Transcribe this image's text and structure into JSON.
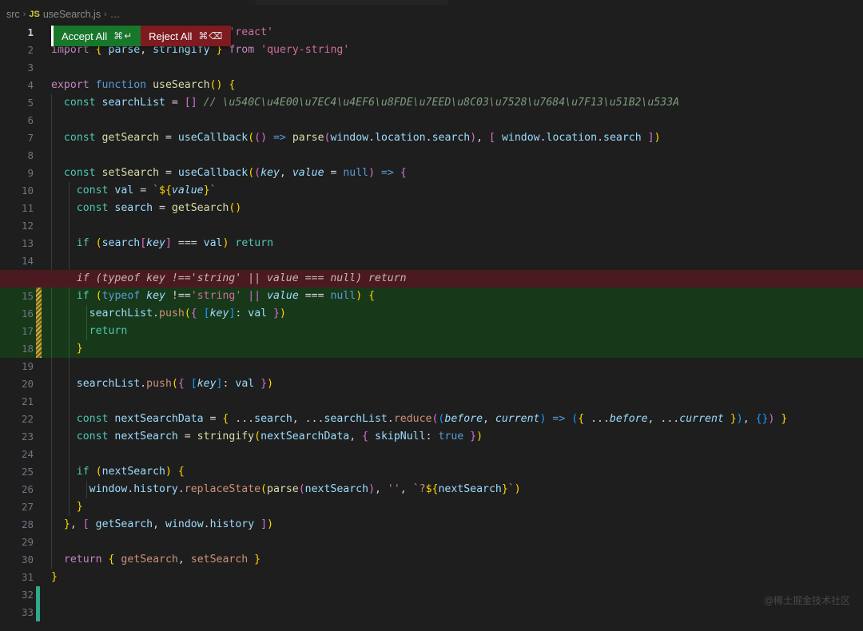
{
  "window": {
    "theme_bg": "#1e1e1e",
    "tabs_hint": "partially cut off tab strip at top"
  },
  "breadcrumb": {
    "folder": "src",
    "separator": "›",
    "file_badge": "JS",
    "file": "useSearch.js",
    "more": "…"
  },
  "diff_actions": {
    "accept_label": "Accept All",
    "accept_shortcut": "⌘↵",
    "accept_color": "#17772b",
    "reject_label": "Reject All",
    "reject_shortcut": "⌘⌫",
    "reject_color": "#7d1b20"
  },
  "watermark": "@稀土掘金技术社区",
  "editor": {
    "language": "javascript",
    "removed_bg": "#4b1a20",
    "added_bg": "#18381a",
    "gutter_changed_color": "#cdae3d",
    "gutter_added_color": "#2ea98b",
    "lines": [
      {
        "n": "1",
        "text": "import { useCallback } from 'react'"
      },
      {
        "n": "2",
        "text": "import { parse, stringify } from 'query-string'"
      },
      {
        "n": "3",
        "text": ""
      },
      {
        "n": "4",
        "text": "export function useSearch() {"
      },
      {
        "n": "5",
        "text": "  const searchList = [] // 同一组件连续调用的缓冲区"
      },
      {
        "n": "6",
        "text": ""
      },
      {
        "n": "7",
        "text": "  const getSearch = useCallback(() => parse(window.location.search), [ window.location.search ])"
      },
      {
        "n": "8",
        "text": ""
      },
      {
        "n": "9",
        "text": "  const setSearch = useCallback((key, value = null) => {"
      },
      {
        "n": "10",
        "text": "    const val = `${value}`"
      },
      {
        "n": "11",
        "text": "    const search = getSearch()"
      },
      {
        "n": "12",
        "text": ""
      },
      {
        "n": "13",
        "text": "    if (search[key] === val) return"
      },
      {
        "n": "14",
        "text": ""
      },
      {
        "n": "",
        "text": "    if (typeof key !=='string' || value === null) return",
        "diff": "removed"
      },
      {
        "n": "15",
        "text": "    if (typeof key !=='string' || value === null) {",
        "diff": "added"
      },
      {
        "n": "16",
        "text": "      searchList.push({ [key]: val })",
        "diff": "added"
      },
      {
        "n": "17",
        "text": "      return",
        "diff": "added"
      },
      {
        "n": "18",
        "text": "    }",
        "diff": "added"
      },
      {
        "n": "19",
        "text": ""
      },
      {
        "n": "20",
        "text": "    searchList.push({ [key]: val })"
      },
      {
        "n": "21",
        "text": ""
      },
      {
        "n": "22",
        "text": "    const nextSearchData = { ...search, ...searchList.reduce((before, current) => ({ ...before, ...current }), {}) }"
      },
      {
        "n": "23",
        "text": "    const nextSearch = stringify(nextSearchData, { skipNull: true })"
      },
      {
        "n": "24",
        "text": ""
      },
      {
        "n": "25",
        "text": "    if (nextSearch) {"
      },
      {
        "n": "26",
        "text": "      window.history.replaceState(parse(nextSearch), '', `?${nextSearch}`)"
      },
      {
        "n": "27",
        "text": "    }"
      },
      {
        "n": "28",
        "text": "  }, [ getSearch, window.history ])"
      },
      {
        "n": "29",
        "text": ""
      },
      {
        "n": "30",
        "text": "  return { getSearch, setSearch }"
      },
      {
        "n": "31",
        "text": "}"
      },
      {
        "n": "32",
        "text": ""
      },
      {
        "n": "33",
        "text": ""
      }
    ]
  }
}
